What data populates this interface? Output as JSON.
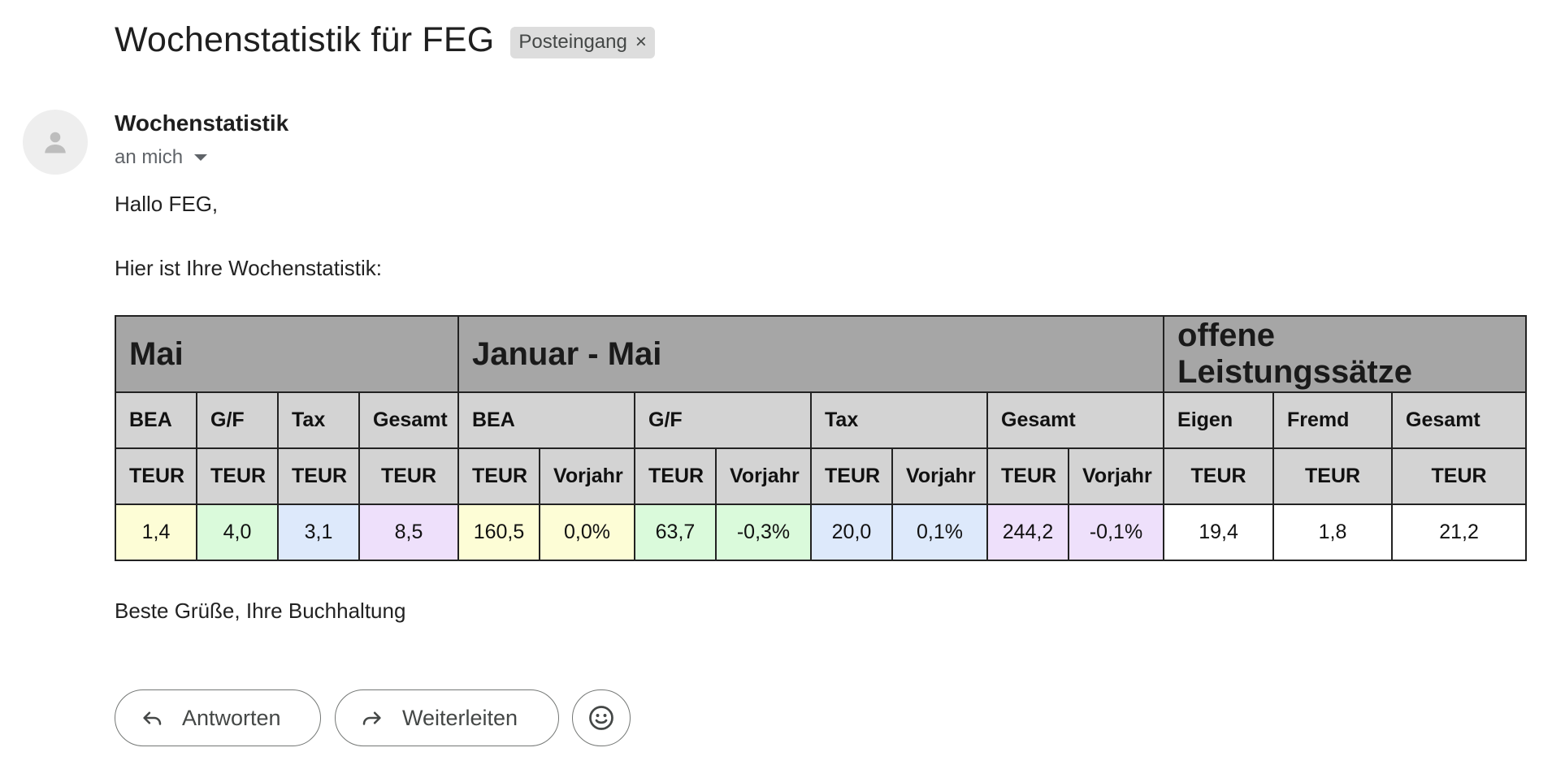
{
  "email": {
    "subject": "Wochenstatistik für FEG",
    "label_chip": "Posteingang",
    "label_remove_icon": "×",
    "sender": "Wochenstatistik",
    "recipient": "an mich",
    "greeting": "Hallo FEG,",
    "intro": "Hier ist Ihre Wochenstatistik:",
    "closing": "Beste Grüße, Ihre Buchhaltung"
  },
  "table": {
    "groups": {
      "month": "Mai",
      "ytd": "Januar - Mai",
      "open": "offene Leistungssätze"
    },
    "headers": {
      "m_bea": "BEA",
      "m_gf": "G/F",
      "m_tax": "Tax",
      "m_total": "Gesamt",
      "y_bea": "BEA",
      "y_gf": "G/F",
      "y_tax": "Tax",
      "y_total": "Gesamt",
      "o_own": "Eigen",
      "o_ext": "Fremd",
      "o_total": "Gesamt"
    },
    "units": {
      "teur": "TEUR",
      "prev": "Vorjahr"
    },
    "data": {
      "m_bea": "1,4",
      "m_gf": "4,0",
      "m_tax": "3,1",
      "m_total": "8,5",
      "y_bea": "160,5",
      "y_bea_prev": "0,0%",
      "y_gf": "63,7",
      "y_gf_prev": "-0,3%",
      "y_tax": "20,0",
      "y_tax_prev": "0,1%",
      "y_total": "244,2",
      "y_total_prev": "-0,1%",
      "o_own": "19,4",
      "o_ext": "1,8",
      "o_total": "21,2"
    },
    "colors": {
      "bea": "#fdfdd6",
      "gf": "#dafadb",
      "tax": "#dde9fb",
      "total": "#eee0fb",
      "negative": "#e0211b",
      "group_header": "#a6a6a6",
      "sub_header": "#d3d3d3"
    }
  },
  "actions": {
    "reply": "Antworten",
    "forward": "Weiterleiten",
    "reply_icon": "reply-arrow-icon",
    "forward_icon": "forward-arrow-icon",
    "emoji_icon": "smiley-icon"
  }
}
